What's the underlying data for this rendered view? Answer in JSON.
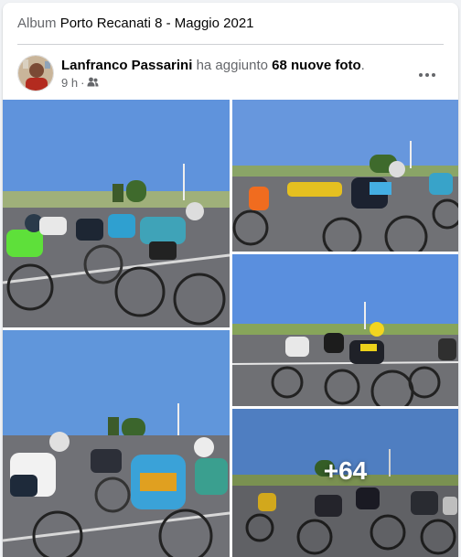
{
  "album": {
    "prefix": "Album",
    "name": "Porto Recanati 8 - Maggio 2021"
  },
  "post": {
    "author": "Lanfranco Passarini",
    "action_before": "ha aggiunto",
    "action_count": "68 nuove foto",
    "action_after": ".",
    "time": "9 h",
    "separator": "·",
    "audience_icon": "friends-icon"
  },
  "photos": [
    {
      "label": "cyclists-peloton-1"
    },
    {
      "label": "cyclists-peloton-2"
    },
    {
      "label": "cyclists-peloton-3"
    },
    {
      "label": "cyclists-peloton-4"
    },
    {
      "label": "cyclists-peloton-5"
    }
  ],
  "more_photos": "+64",
  "colors": {
    "sky": "#5f8fd6",
    "road": "#6f6f73",
    "grass": "#7aa04a",
    "accent_text": "#65676b"
  }
}
